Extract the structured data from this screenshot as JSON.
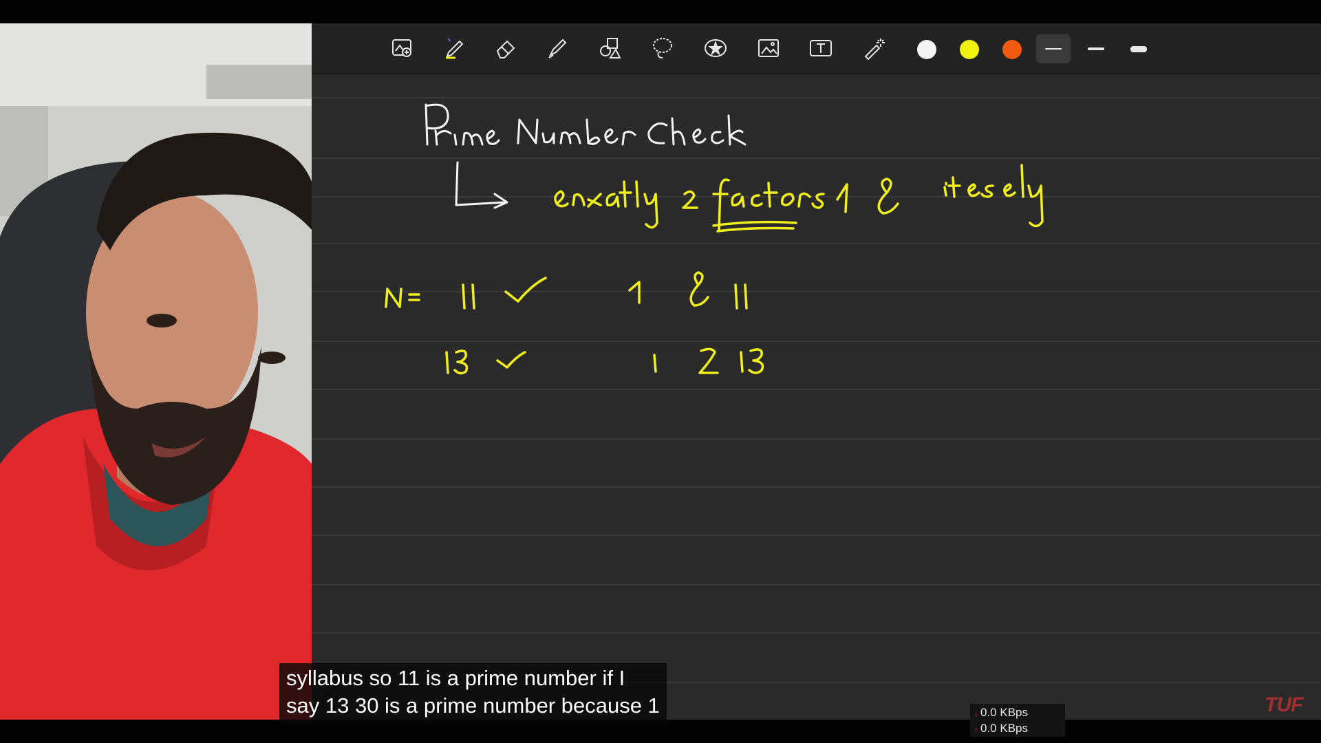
{
  "toolbar": {
    "tools": [
      {
        "icon": "image-add-icon"
      },
      {
        "icon": "pen-icon"
      },
      {
        "icon": "eraser-icon"
      },
      {
        "icon": "highlighter-icon"
      },
      {
        "icon": "shapes-icon"
      },
      {
        "icon": "lasso-icon"
      },
      {
        "icon": "sticker-icon"
      },
      {
        "icon": "picture-icon"
      },
      {
        "icon": "text-box-icon"
      },
      {
        "icon": "laser-pointer-icon"
      }
    ],
    "colors": [
      "#f5f5f5",
      "#f2f20f",
      "#f25a12"
    ],
    "selected_stroke": "thin"
  },
  "board": {
    "title": "Prime Number Check",
    "definition": "exactly 2 factors 1 & itself",
    "examples": [
      {
        "label": "N = 11",
        "mark": "✓",
        "factors": "1 & 11"
      },
      {
        "label": "13",
        "mark": "✓",
        "factors": "1 & 13"
      }
    ]
  },
  "caption": {
    "line1": "syllabus so 11 is a prime number if I",
    "line2": "say 13 30 is a prime number because 1"
  },
  "network": {
    "down": "0.0 KBps",
    "up": "0.0 KBps",
    "down_color": "#d42a2a",
    "up_color": "#d42a2a"
  },
  "logo": "TUF"
}
